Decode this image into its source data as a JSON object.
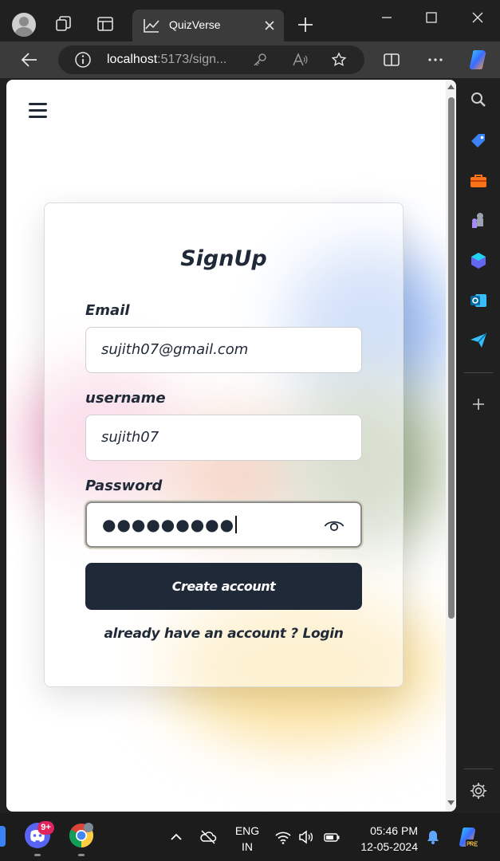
{
  "browser": {
    "tab_title": "QuizVerse",
    "url_host": "localhost",
    "url_rest": ":5173/sign..."
  },
  "page": {
    "title": "SignUp",
    "email_label": "Email",
    "email_value": "sujith07@gmail.com",
    "username_label": "username",
    "username_value": "sujith07",
    "password_label": "Password",
    "password_masked": "●●●●●●●●●",
    "submit_label": "Create account",
    "login_prompt": "already have an account ? ",
    "login_link": "Login"
  },
  "taskbar": {
    "discord_badge": "9+",
    "lang_line1": "ENG",
    "lang_line2": "IN",
    "time": "05:46 PM",
    "date": "12-05-2024"
  },
  "colors": {
    "primary": "#1f2937",
    "browser_dark": "#202020",
    "toolbar": "#3b3b3b"
  }
}
